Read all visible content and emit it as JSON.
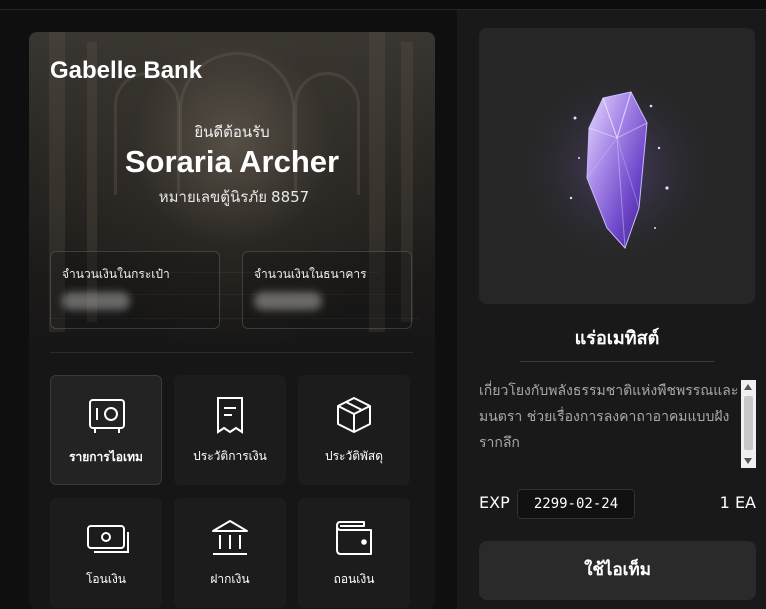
{
  "bank": {
    "title": "Gabelle Bank",
    "welcome": "ยินดีต้อนรับ",
    "user_name": "Soraria Archer",
    "account_label": "หมายเลขตู้นิรภัย",
    "account_number": "8857",
    "wallet_label": "จำนวนเงินในกระเป๋า",
    "bank_label": "จำนวนเงินในธนาคาร"
  },
  "menu": [
    {
      "label": "รายการไอเทม",
      "icon": "safe-icon",
      "active": true
    },
    {
      "label": "ประวัติการเงิน",
      "icon": "receipt-icon",
      "active": false
    },
    {
      "label": "ประวัติพัสดุ",
      "icon": "box-icon",
      "active": false
    },
    {
      "label": "โอนเงิน",
      "icon": "cash-icon",
      "active": false
    },
    {
      "label": "ฝากเงิน",
      "icon": "bank-building-icon",
      "active": false
    },
    {
      "label": "ถอนเงิน",
      "icon": "wallet-icon",
      "active": false
    }
  ],
  "item": {
    "name": "แร่อเมทิสต์",
    "description": "เกี่ยวโยงกับพลังธรรมชาติแห่งพืชพรรณและมนตรา ช่วยเรื่องการลงคาถาอาคมแบบฝังรากลึก",
    "exp_label": "EXP",
    "exp_date": "2299-02-24",
    "quantity": "1 EA",
    "use_button": "ใช้ไอเท็ม",
    "image_icon": "amethyst-crystal-icon"
  },
  "colors": {
    "background": "#0d0d0d",
    "card": "#1c1c1c",
    "accent_crystal": "#9b7fe0",
    "button": "#2a2a2a"
  }
}
